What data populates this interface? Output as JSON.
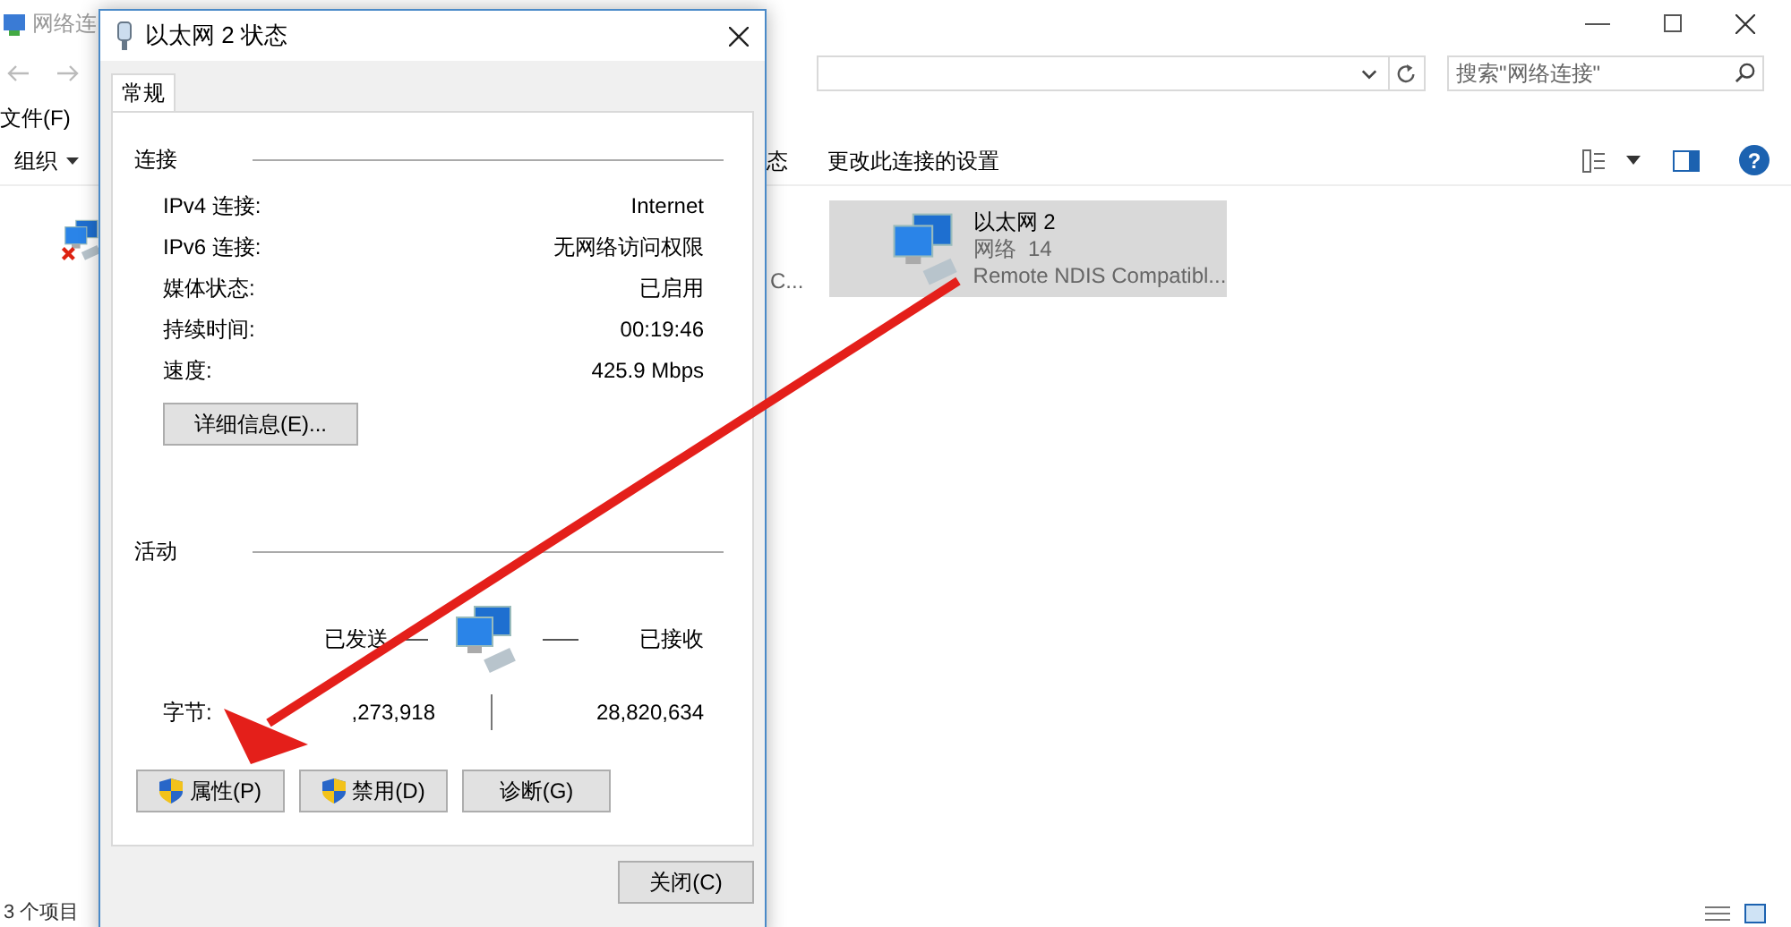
{
  "explorer": {
    "title": "网络连",
    "search": {
      "placeholder": "搜索\"网络连接\""
    },
    "menu": [
      "文件(F)"
    ],
    "toolbar": {
      "organize": "组织",
      "commands": [
        "态",
        "更改此连接的设置"
      ],
      "help": "?"
    },
    "items": [
      {
        "kind": "icon",
        "error": true,
        "selected": false
      },
      {
        "kind": "text",
        "text": "C...",
        "selected": false
      },
      {
        "kind": "full",
        "name": "以太网 2",
        "status": "网络  14",
        "device": "Remote NDIS Compatibl...",
        "selected": true
      }
    ],
    "status_bar": "3 个项目"
  },
  "dialog": {
    "title": "以太网 2 状态",
    "tabs": [
      {
        "label": "常规",
        "selected": true
      }
    ],
    "connection": {
      "heading": "连接",
      "rows": [
        {
          "label": "IPv4 连接:",
          "value": "Internet"
        },
        {
          "label": "IPv6 连接:",
          "value": "无网络访问权限"
        },
        {
          "label": "媒体状态:",
          "value": "已启用"
        },
        {
          "label": "持续时间:",
          "value": "00:19:46"
        },
        {
          "label": "速度:",
          "value": "425.9 Mbps"
        }
      ],
      "details_button": "详细信息(E)..."
    },
    "activity": {
      "heading": "活动",
      "sent_label": "已发送",
      "received_label": "已接收",
      "bytes_label": "字节:",
      "bytes_sent": ",273,918",
      "bytes_received": "28,820,634"
    },
    "buttons": [
      {
        "label": "属性(P)",
        "shield": true
      },
      {
        "label": "禁用(D)",
        "shield": true
      },
      {
        "label": "诊断(G)",
        "shield": false
      }
    ],
    "close_button": "关闭(C)"
  }
}
